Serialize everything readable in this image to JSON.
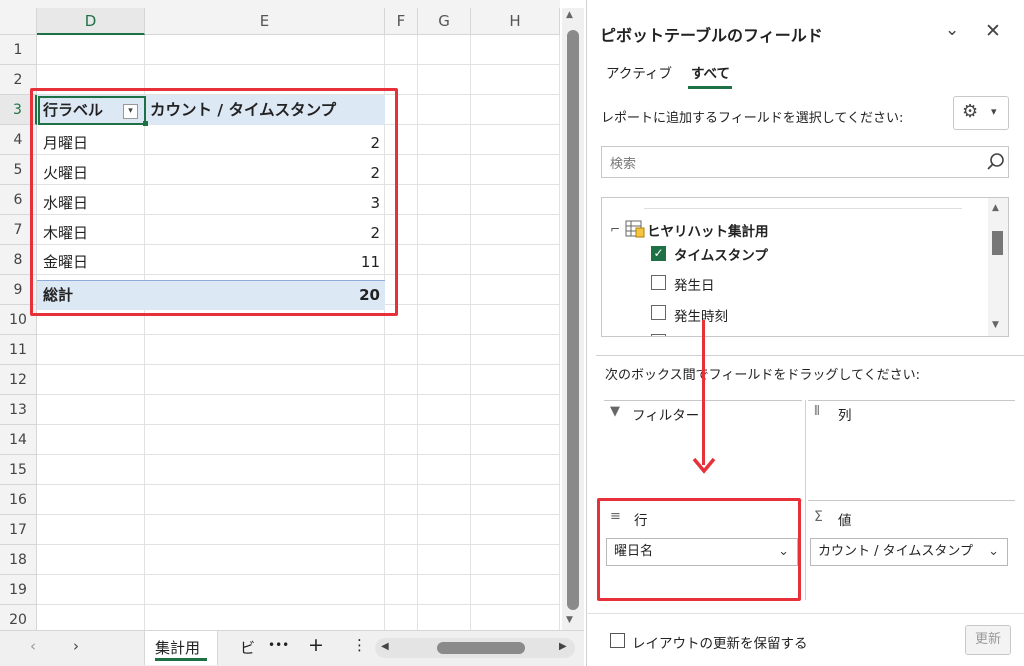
{
  "sheet": {
    "columns": [
      "D",
      "E",
      "F",
      "G",
      "H"
    ],
    "rows": [
      "1",
      "2",
      "3",
      "4",
      "5",
      "6",
      "7",
      "8",
      "9",
      "10",
      "11",
      "12",
      "13",
      "14",
      "15",
      "16",
      "17",
      "18",
      "19",
      "20"
    ],
    "pivot": {
      "header_label": "行ラベル",
      "header_value": "カウント / タイムスタンプ",
      "items": [
        {
          "label": "月曜日",
          "value": "2"
        },
        {
          "label": "火曜日",
          "value": "2"
        },
        {
          "label": "水曜日",
          "value": "3"
        },
        {
          "label": "木曜日",
          "value": "2"
        },
        {
          "label": "金曜日",
          "value": "11"
        }
      ],
      "total_label": "総計",
      "total_value": "20"
    }
  },
  "tabs": {
    "active": "集計用",
    "next": "ビ",
    "more": "•••",
    "add": "+",
    "menu": "⋮"
  },
  "pane": {
    "title": "ピボットテーブルのフィールド",
    "tab_active": "アクティブ",
    "tab_all": "すべて",
    "instruction": "レポートに追加するフィールドを選択してください:",
    "search_placeholder": "検索",
    "table_name": "ヒヤリハット集計用",
    "fields": [
      {
        "name": "タイムスタンプ",
        "checked": true
      },
      {
        "name": "発生日",
        "checked": false
      },
      {
        "name": "発生時刻",
        "checked": false
      }
    ],
    "drag_instruction": "次のボックス間でフィールドをドラッグしてください:",
    "filter_label": "フィルター",
    "column_label": "列",
    "row_label": "行",
    "values_label": "値",
    "row_field": "曜日名",
    "values_field": "カウント / タイムスタンプ",
    "defer_label": "レイアウトの更新を保留する",
    "update_button": "更新"
  },
  "colors": {
    "accent": "#1e7145",
    "highlight": "#e8303a",
    "pivot_fill": "#dde8f5"
  }
}
